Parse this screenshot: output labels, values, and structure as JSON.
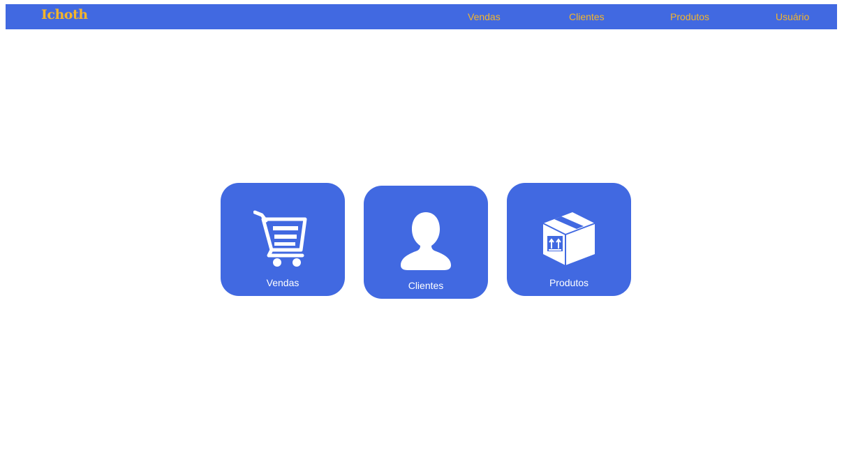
{
  "navbar": {
    "brand": "Ichoth",
    "links": [
      {
        "label": "Vendas"
      },
      {
        "label": "Clientes"
      },
      {
        "label": "Produtos"
      },
      {
        "label": "Usuário"
      }
    ]
  },
  "cards": [
    {
      "label": "Vendas",
      "icon": "shopping-cart-icon"
    },
    {
      "label": "Clientes",
      "icon": "user-silhouette-icon"
    },
    {
      "label": "Produtos",
      "icon": "package-box-icon"
    }
  ],
  "colors": {
    "primary": "#4169e1",
    "accent": "#f4b52b",
    "background": "#ffffff",
    "card_text": "#ffffff"
  }
}
